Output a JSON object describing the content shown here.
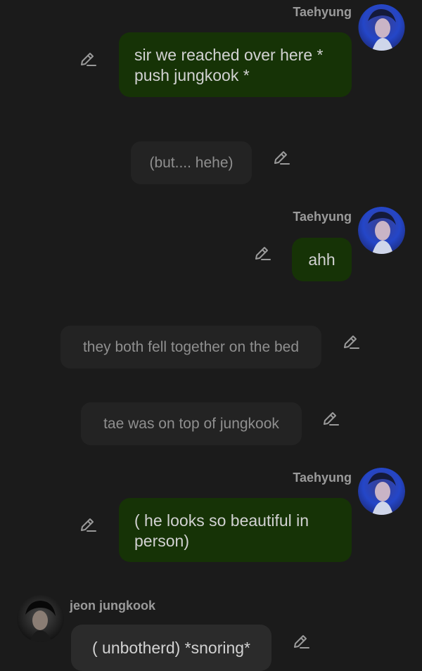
{
  "messages": [
    {
      "type": "character",
      "sender": "Taehyung",
      "text": "sir  we reached over here * push jungkook *"
    },
    {
      "type": "narration",
      "text": "(but.... hehe)"
    },
    {
      "type": "character",
      "sender": "Taehyung",
      "text": "ahh"
    },
    {
      "type": "narration",
      "text": "they both fell together on the bed"
    },
    {
      "type": "narration",
      "text": "tae was on top of jungkook"
    },
    {
      "type": "character",
      "sender": "Taehyung",
      "text": "( he looks so beautiful in person)"
    },
    {
      "type": "character",
      "sender": "jeon jungkook",
      "text": "( unbotherd) *snoring*"
    }
  ],
  "icons": {
    "edit": "pencil-edit-icon",
    "avatar_taehyung": "taehyung-avatar",
    "avatar_jungkook": "jungkook-avatar"
  },
  "colors": {
    "background": "#1b1b1b",
    "user_bubble": "#163306",
    "narration_bubble": "#232323",
    "other_bubble": "#2b2b2b"
  }
}
